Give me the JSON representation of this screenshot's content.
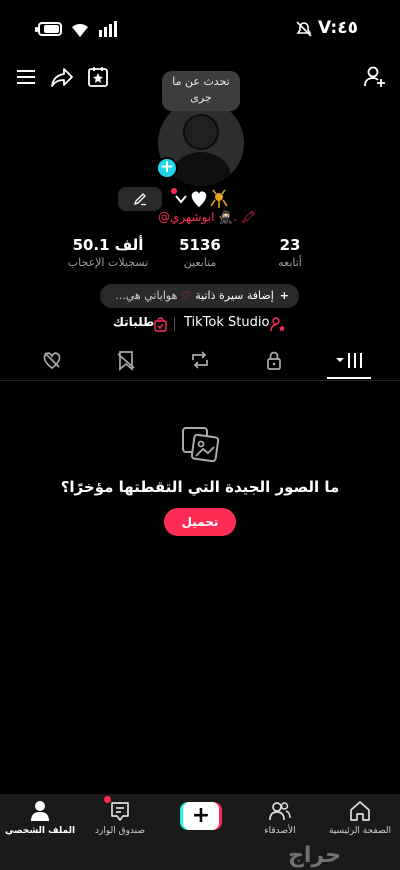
{
  "status_bar": {
    "time": "V:٤٥",
    "battery_level": 0.85,
    "icons": [
      "battery-icon",
      "wifi-icon",
      "signal-icon",
      "mute-icon"
    ]
  },
  "toolbar": {
    "icons": [
      "menu-icon",
      "share-icon",
      "calendar-star-icon",
      "add-friend-icon"
    ]
  },
  "profile": {
    "speech_bubble": "تحدث عن ما جرى",
    "handle": "@ابوشهري 🥷🏻. 🖍",
    "stats": {
      "likes_value": "50.1 ألف",
      "likes_label": "تسجيلات الإعجاب",
      "followers_value": "5136",
      "followers_label": "متابعين",
      "following_value": "23",
      "following_label": "أتابعه"
    },
    "bio_button": {
      "add_label": "إضافة سيرة ذاتية",
      "hint": "هواياتي هي..."
    },
    "studio_label": "TikTok Studio",
    "orders_label": "طلباتك"
  },
  "tabs": [
    "videos-grid-icon",
    "private-lock-icon",
    "reposts-icon",
    "favorites-icon",
    "liked-icon"
  ],
  "empty_state": {
    "title": "ما الصور الجيدة التي التقطتها مؤخرًا؟",
    "upload_label": "تحميل"
  },
  "bottom_nav": {
    "home": "الصفحة الرئيسية",
    "friends": "الأصدقاء",
    "inbox": "صندوق الوارد",
    "profile": "الملف الشخصي"
  },
  "colors": {
    "accent": "#fe2c55",
    "cyan": "#25f4ee",
    "background": "#000000"
  },
  "watermark": "حراج"
}
